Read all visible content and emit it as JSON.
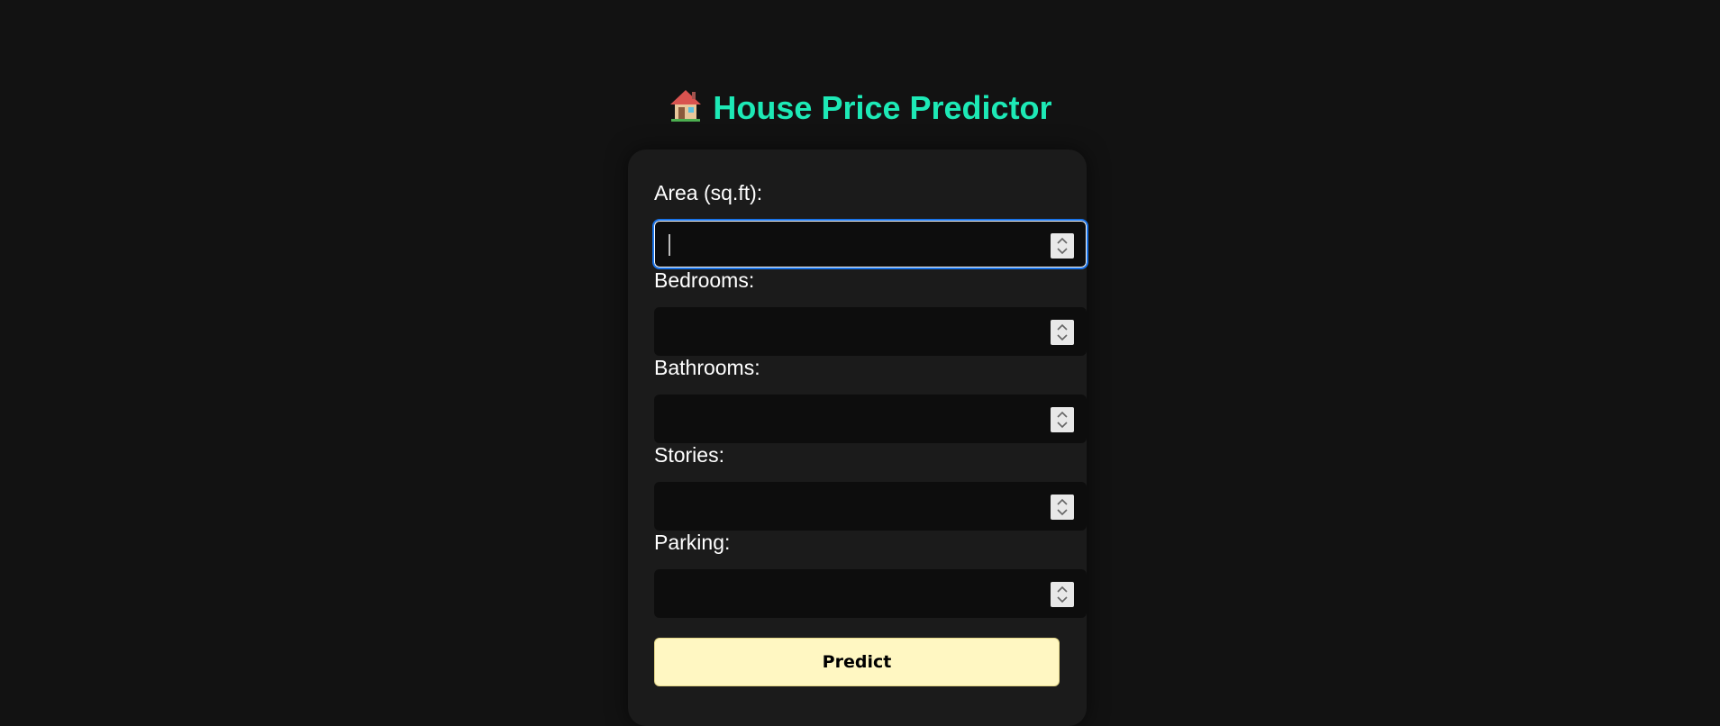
{
  "header": {
    "title": "House Price Predictor",
    "icon": "house-icon"
  },
  "form": {
    "fields": [
      {
        "label": "Area (sq.ft):",
        "value": "",
        "focused": true
      },
      {
        "label": "Bedrooms:",
        "value": ""
      },
      {
        "label": "Bathrooms:",
        "value": ""
      },
      {
        "label": "Stories:",
        "value": ""
      },
      {
        "label": "Parking:",
        "value": ""
      }
    ],
    "submit_label": "Predict"
  },
  "colors": {
    "background": "#121212",
    "card": "#1b1b1b",
    "title": "#1de9b6",
    "button": "#fff7c2",
    "focus_ring": "#1a73e8"
  }
}
